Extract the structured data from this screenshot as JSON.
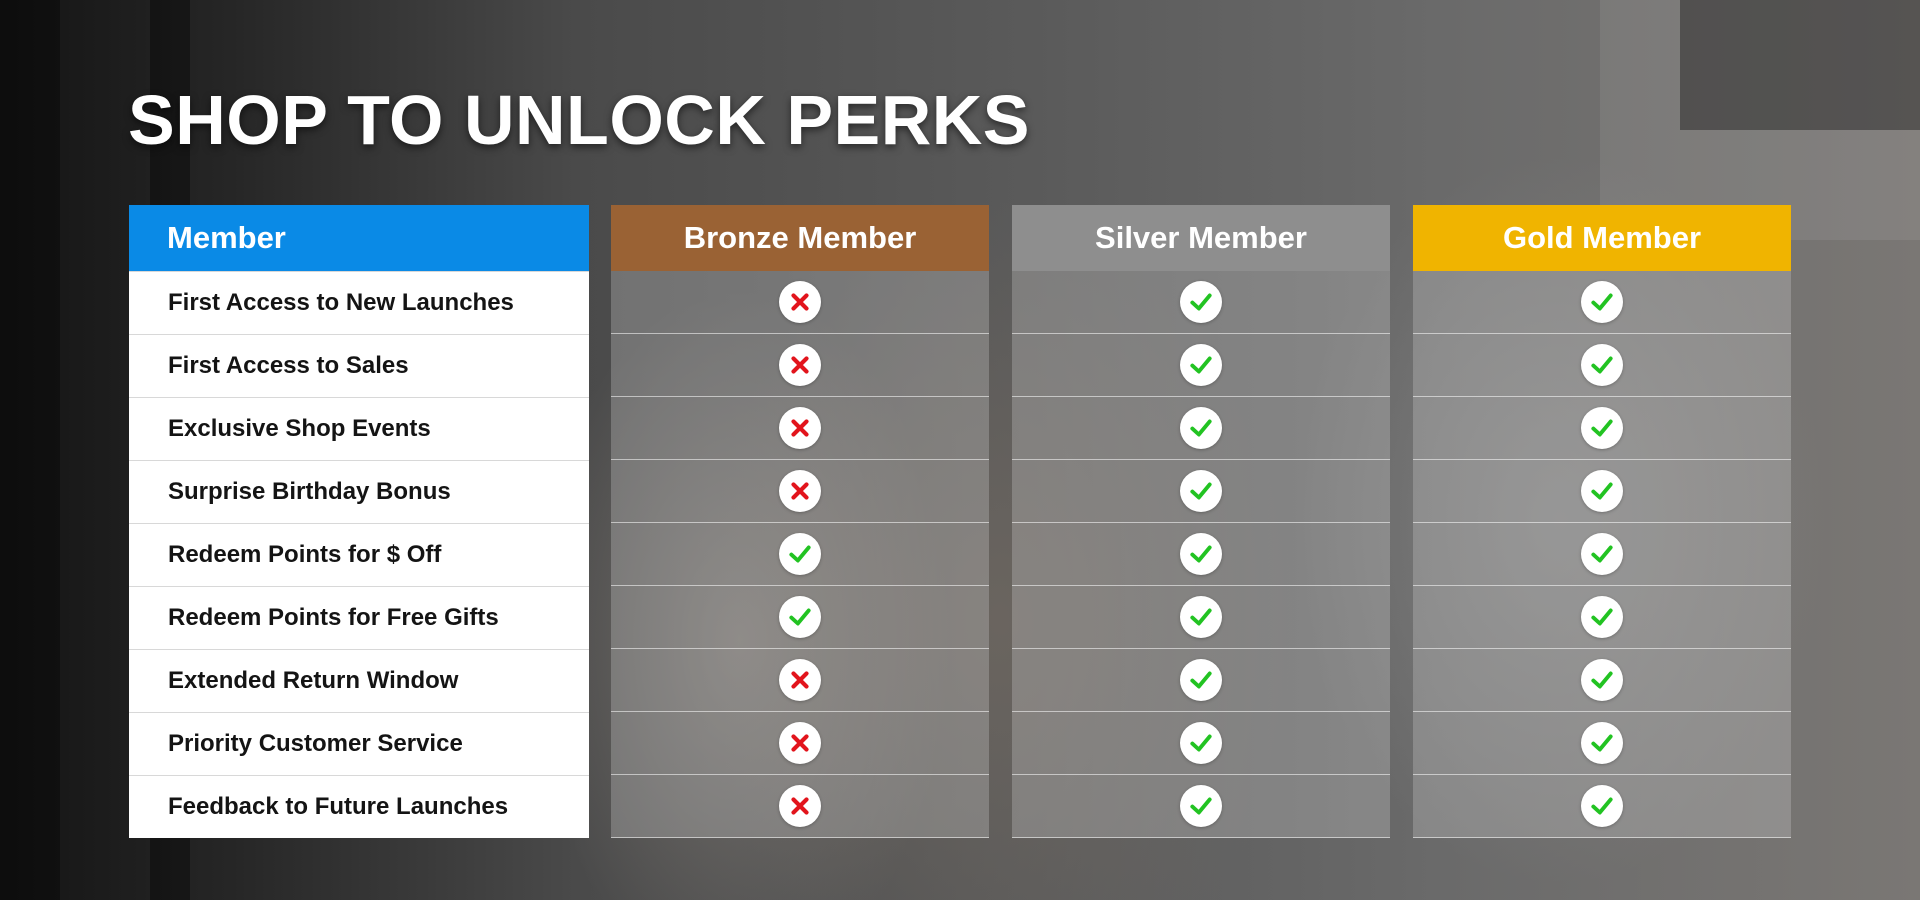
{
  "title": "SHOP TO UNLOCK PERKS",
  "table": {
    "feature_header": "Member",
    "features": [
      "First Access to New Launches",
      "First Access to Sales",
      "Exclusive Shop Events",
      "Surprise Birthday Bonus",
      "Redeem Points for $ Off",
      "Redeem Points for Free Gifts",
      "Extended Return Window",
      "Priority Customer Service",
      "Feedback to Future Launches"
    ],
    "tiers": [
      {
        "name": "Bronze Member",
        "color": "#9a6234",
        "perks": [
          false,
          false,
          false,
          false,
          true,
          true,
          false,
          false,
          false
        ]
      },
      {
        "name": "Silver Member",
        "color": "#8e8e8e",
        "perks": [
          true,
          true,
          true,
          true,
          true,
          true,
          true,
          true,
          true
        ]
      },
      {
        "name": "Gold Member",
        "color": "#f0b400",
        "perks": [
          true,
          true,
          true,
          true,
          true,
          true,
          true,
          true,
          true
        ]
      }
    ]
  },
  "colors": {
    "feature_header_bg": "#0a8ae6",
    "check": "#22c322",
    "cross": "#e2141c"
  },
  "icons": {
    "included": "check-icon",
    "excluded": "cross-icon"
  }
}
